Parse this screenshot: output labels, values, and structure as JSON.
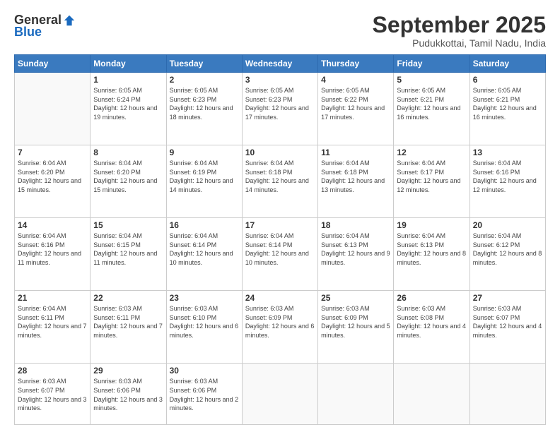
{
  "header": {
    "logo": {
      "general": "General",
      "blue": "Blue"
    },
    "title": "September 2025",
    "subtitle": "Pudukkottai, Tamil Nadu, India"
  },
  "weekdays": [
    "Sunday",
    "Monday",
    "Tuesday",
    "Wednesday",
    "Thursday",
    "Friday",
    "Saturday"
  ],
  "weeks": [
    [
      null,
      {
        "day": 1,
        "sunrise": "6:05 AM",
        "sunset": "6:24 PM",
        "daylight": "12 hours and 19 minutes."
      },
      {
        "day": 2,
        "sunrise": "6:05 AM",
        "sunset": "6:23 PM",
        "daylight": "12 hours and 18 minutes."
      },
      {
        "day": 3,
        "sunrise": "6:05 AM",
        "sunset": "6:23 PM",
        "daylight": "12 hours and 17 minutes."
      },
      {
        "day": 4,
        "sunrise": "6:05 AM",
        "sunset": "6:22 PM",
        "daylight": "12 hours and 17 minutes."
      },
      {
        "day": 5,
        "sunrise": "6:05 AM",
        "sunset": "6:21 PM",
        "daylight": "12 hours and 16 minutes."
      },
      {
        "day": 6,
        "sunrise": "6:05 AM",
        "sunset": "6:21 PM",
        "daylight": "12 hours and 16 minutes."
      }
    ],
    [
      {
        "day": 7,
        "sunrise": "6:04 AM",
        "sunset": "6:20 PM",
        "daylight": "12 hours and 15 minutes."
      },
      {
        "day": 8,
        "sunrise": "6:04 AM",
        "sunset": "6:20 PM",
        "daylight": "12 hours and 15 minutes."
      },
      {
        "day": 9,
        "sunrise": "6:04 AM",
        "sunset": "6:19 PM",
        "daylight": "12 hours and 14 minutes."
      },
      {
        "day": 10,
        "sunrise": "6:04 AM",
        "sunset": "6:18 PM",
        "daylight": "12 hours and 14 minutes."
      },
      {
        "day": 11,
        "sunrise": "6:04 AM",
        "sunset": "6:18 PM",
        "daylight": "12 hours and 13 minutes."
      },
      {
        "day": 12,
        "sunrise": "6:04 AM",
        "sunset": "6:17 PM",
        "daylight": "12 hours and 12 minutes."
      },
      {
        "day": 13,
        "sunrise": "6:04 AM",
        "sunset": "6:16 PM",
        "daylight": "12 hours and 12 minutes."
      }
    ],
    [
      {
        "day": 14,
        "sunrise": "6:04 AM",
        "sunset": "6:16 PM",
        "daylight": "12 hours and 11 minutes."
      },
      {
        "day": 15,
        "sunrise": "6:04 AM",
        "sunset": "6:15 PM",
        "daylight": "12 hours and 11 minutes."
      },
      {
        "day": 16,
        "sunrise": "6:04 AM",
        "sunset": "6:14 PM",
        "daylight": "12 hours and 10 minutes."
      },
      {
        "day": 17,
        "sunrise": "6:04 AM",
        "sunset": "6:14 PM",
        "daylight": "12 hours and 10 minutes."
      },
      {
        "day": 18,
        "sunrise": "6:04 AM",
        "sunset": "6:13 PM",
        "daylight": "12 hours and 9 minutes."
      },
      {
        "day": 19,
        "sunrise": "6:04 AM",
        "sunset": "6:13 PM",
        "daylight": "12 hours and 8 minutes."
      },
      {
        "day": 20,
        "sunrise": "6:04 AM",
        "sunset": "6:12 PM",
        "daylight": "12 hours and 8 minutes."
      }
    ],
    [
      {
        "day": 21,
        "sunrise": "6:04 AM",
        "sunset": "6:11 PM",
        "daylight": "12 hours and 7 minutes."
      },
      {
        "day": 22,
        "sunrise": "6:03 AM",
        "sunset": "6:11 PM",
        "daylight": "12 hours and 7 minutes."
      },
      {
        "day": 23,
        "sunrise": "6:03 AM",
        "sunset": "6:10 PM",
        "daylight": "12 hours and 6 minutes."
      },
      {
        "day": 24,
        "sunrise": "6:03 AM",
        "sunset": "6:09 PM",
        "daylight": "12 hours and 6 minutes."
      },
      {
        "day": 25,
        "sunrise": "6:03 AM",
        "sunset": "6:09 PM",
        "daylight": "12 hours and 5 minutes."
      },
      {
        "day": 26,
        "sunrise": "6:03 AM",
        "sunset": "6:08 PM",
        "daylight": "12 hours and 4 minutes."
      },
      {
        "day": 27,
        "sunrise": "6:03 AM",
        "sunset": "6:07 PM",
        "daylight": "12 hours and 4 minutes."
      }
    ],
    [
      {
        "day": 28,
        "sunrise": "6:03 AM",
        "sunset": "6:07 PM",
        "daylight": "12 hours and 3 minutes."
      },
      {
        "day": 29,
        "sunrise": "6:03 AM",
        "sunset": "6:06 PM",
        "daylight": "12 hours and 3 minutes."
      },
      {
        "day": 30,
        "sunrise": "6:03 AM",
        "sunset": "6:06 PM",
        "daylight": "12 hours and 2 minutes."
      },
      null,
      null,
      null,
      null
    ]
  ]
}
